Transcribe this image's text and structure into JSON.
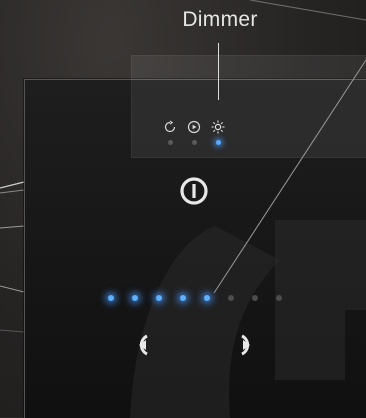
{
  "callout": {
    "title": "Dimmer"
  },
  "modes": {
    "items": [
      {
        "name": "auto-mode",
        "icon": "refresh-circle-icon",
        "active": false
      },
      {
        "name": "play-mode",
        "icon": "play-circle-icon",
        "active": false
      },
      {
        "name": "light-mode",
        "icon": "sun-icon",
        "active": true
      }
    ]
  },
  "power": {
    "icon": "power-icon"
  },
  "dimmer": {
    "level_count": 8,
    "level": 5
  },
  "navigation": {
    "previous_icon": "chevron-left-icon",
    "next_icon": "chevron-right-icon"
  },
  "colors": {
    "accent": "#5fb0ff",
    "inactive_dot": "#4c4c4c",
    "icon_light": "#e8e8e8",
    "panel": "#141414"
  }
}
